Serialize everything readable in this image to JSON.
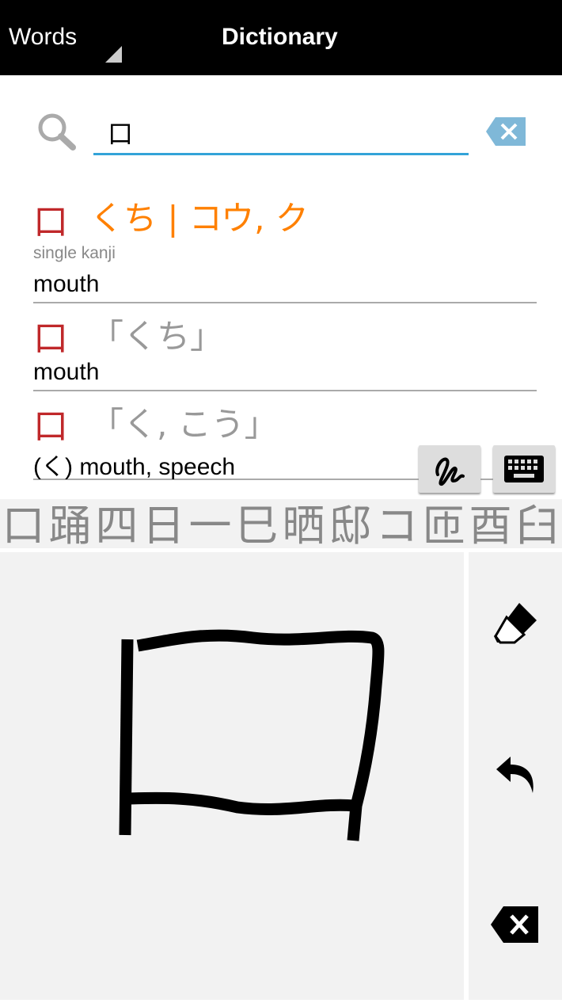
{
  "header": {
    "dropdown_label": "Words",
    "title": "Dictionary"
  },
  "search": {
    "value": "口"
  },
  "results": [
    {
      "kanji": "口",
      "reading": "くち | コウ, ク",
      "tag": "single kanji",
      "meaning": "mouth"
    },
    {
      "kanji": "口",
      "reading": "「くち」",
      "meaning": "mouth"
    },
    {
      "kanji": "口",
      "reading": "「く, こう」",
      "meaning": "(く) mouth, speech"
    }
  ],
  "candidates": [
    "口",
    "踊",
    "四",
    "日",
    "一",
    "巳",
    "晒",
    "邸",
    "コ",
    "匝",
    "酉",
    "臼"
  ],
  "colors": {
    "accent": "#33a3d8",
    "kanji": "#c0282a",
    "reading": "#ff8000"
  }
}
